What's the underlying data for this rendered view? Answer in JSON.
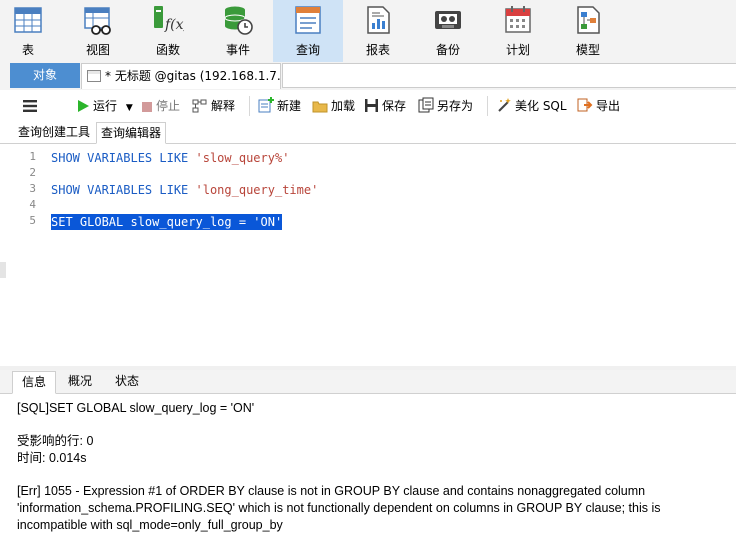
{
  "ribbon": {
    "items": [
      {
        "label": "表",
        "icon": "table-icon"
      },
      {
        "label": "视图",
        "icon": "view-icon"
      },
      {
        "label": "函数",
        "icon": "function-icon"
      },
      {
        "label": "事件",
        "icon": "event-icon"
      },
      {
        "label": "查询",
        "icon": "query-icon",
        "active": true
      },
      {
        "label": "报表",
        "icon": "report-icon"
      },
      {
        "label": "备份",
        "icon": "backup-icon"
      },
      {
        "label": "计划",
        "icon": "schedule-icon"
      },
      {
        "label": "模型",
        "icon": "model-icon"
      }
    ]
  },
  "tabs": {
    "object": "对象",
    "query": "* 无标题 @gitas (192.168.1.7..."
  },
  "toolbar": {
    "run": "运行",
    "stop": "停止",
    "explain": "解释",
    "new": "新建",
    "load": "加载",
    "save": "保存",
    "save_as": "另存为",
    "beautify": "美化 SQL",
    "export": "导出"
  },
  "subtabs": {
    "builder": "查询创建工具",
    "editor": "查询编辑器"
  },
  "editor": {
    "lines": [
      {
        "n": "1",
        "kw": "SHOW VARIABLES LIKE ",
        "str": "'slow_query%'"
      },
      {
        "n": "2",
        "kw": "",
        "str": ""
      },
      {
        "n": "3",
        "kw": "SHOW VARIABLES LIKE ",
        "str": "'long_query_time'"
      },
      {
        "n": "4",
        "kw": "",
        "str": ""
      },
      {
        "n": "5",
        "kw": "SET GLOBAL slow_query_log = ",
        "str": "'ON'"
      }
    ]
  },
  "bottom": {
    "tabs": [
      "信息",
      "概况",
      "状态"
    ],
    "sql_line": "[SQL]SET GLOBAL slow_query_log = 'ON'",
    "affected": "受影响的行: 0",
    "time": "时间: 0.014s",
    "err1": "[Err] 1055 - Expression #1 of ORDER BY clause is not in GROUP BY clause and contains nonaggregated column",
    "err2": "'information_schema.PROFILING.SEQ' which is not functionally dependent on columns in GROUP BY clause; this is",
    "err3": "incompatible with sql_mode=only_full_group_by"
  },
  "colors": {
    "accent": "#4d8ed1",
    "selection": "#0a57d8",
    "keyword": "#1a5cc4",
    "string": "#b8453a",
    "run_green": "#2bb52b"
  }
}
